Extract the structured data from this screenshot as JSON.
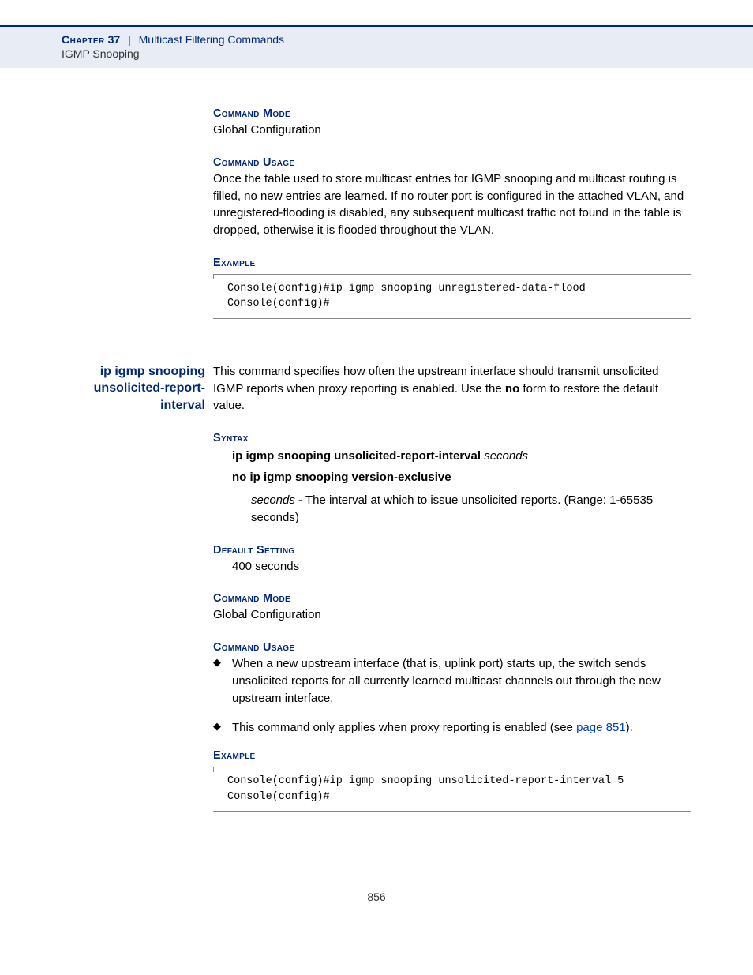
{
  "header": {
    "chapterWord": "Chapter",
    "chapterNum": "37",
    "sep": "|",
    "title": "Multicast Filtering Commands",
    "subtitle": "IGMP Snooping"
  },
  "sec1": {
    "cmdModeH": "Command Mode",
    "cmdModeT": "Global Configuration",
    "cmdUsageH": "Command Usage",
    "cmdUsageT": "Once the table used to store multicast entries for IGMP snooping and multicast routing is filled, no new entries are learned. If no router port is configured in the attached VLAN, and unregistered-flooding is disabled, any subsequent multicast traffic not found in the table is dropped, otherwise it is flooded throughout the VLAN.",
    "exampleH": "Example",
    "codeL1": "Console(config)#ip igmp snooping unregistered-data-flood",
    "codeL2": "Console(config)#"
  },
  "sec2": {
    "sideHeading": "ip igmp snooping unsolicited-report-interval",
    "introA": "This command specifies how often the upstream interface should transmit unsolicited IGMP reports when proxy reporting is enabled. Use the ",
    "introNo": "no",
    "introB": " form to restore the default value.",
    "syntaxH": "Syntax",
    "syntaxL1a": "ip igmp snooping unsolicited-report-interval ",
    "syntaxL1b": "seconds",
    "syntaxL2": "no ip igmp snooping version-exclusive",
    "syntaxDescA": "seconds",
    "syntaxDescB": " - The interval at which to issue unsolicited reports. (Range: 1-65535 seconds)",
    "defaultH": "Default Setting",
    "defaultT": "400 seconds",
    "cmdModeH": "Command Mode",
    "cmdModeT": "Global Configuration",
    "cmdUsageH": "Command Usage",
    "bullet1": "When a new upstream interface (that is, uplink port) starts up, the switch sends unsolicited reports for all currently learned multicast channels out through the new upstream interface.",
    "bullet2a": "This command only applies when proxy reporting is enabled (see ",
    "bullet2link": "page 851",
    "bullet2b": ").",
    "exampleH": "Example",
    "codeL1": "Console(config)#ip igmp snooping unsolicited-report-interval 5",
    "codeL2": "Console(config)#"
  },
  "footer": {
    "text": "–  856  –"
  }
}
